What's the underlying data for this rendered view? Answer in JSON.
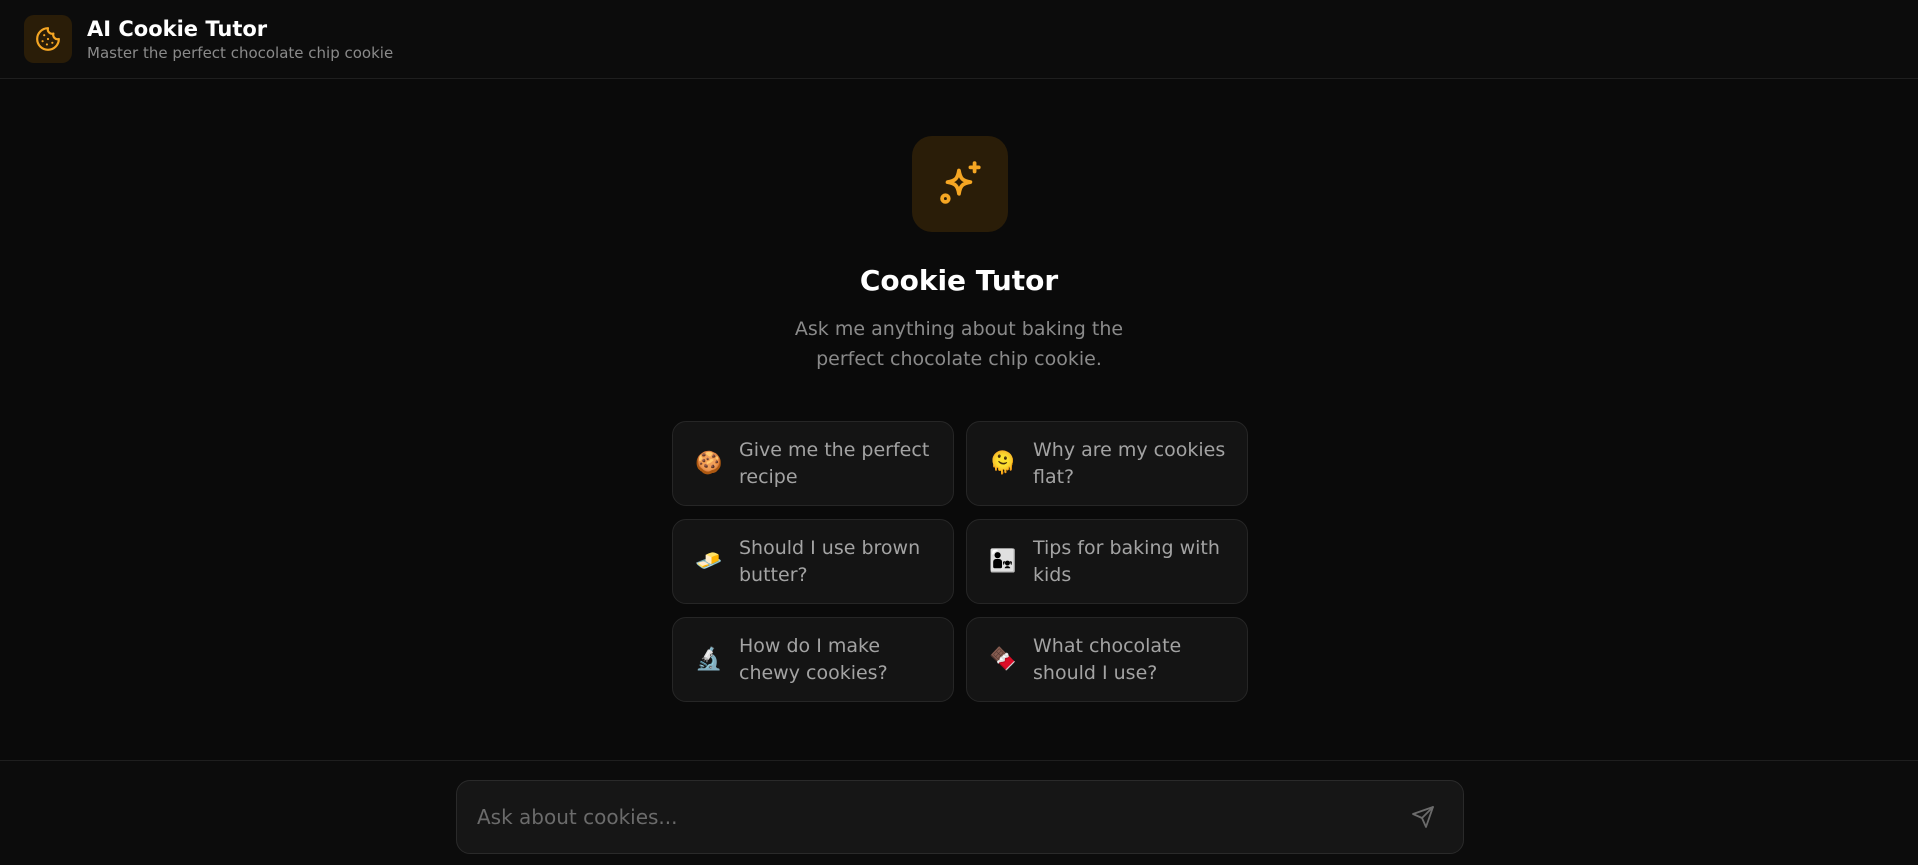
{
  "header": {
    "title": "AI Cookie Tutor",
    "subtitle": "Master the perfect chocolate chip cookie",
    "logo_icon": "cookie-icon"
  },
  "hero": {
    "icon": "sparkles-icon",
    "title": "Cookie Tutor",
    "subtitle": "Ask me anything about baking the perfect chocolate chip cookie."
  },
  "suggestions": [
    {
      "emoji": "🍪",
      "label": "Give me the perfect recipe"
    },
    {
      "emoji": "🫠",
      "label": "Why are my cookies flat?"
    },
    {
      "emoji": "🧈",
      "label": "Should I use brown butter?"
    },
    {
      "emoji": "👨‍👧",
      "label": "Tips for baking with kids"
    },
    {
      "emoji": "🔬",
      "label": "How do I make chewy cookies?"
    },
    {
      "emoji": "🍫",
      "label": "What chocolate should I use?"
    }
  ],
  "composer": {
    "placeholder": "Ask about cookies...",
    "send_icon": "send-icon"
  },
  "colors": {
    "accent": "#f5a623",
    "background": "#0a0a0a",
    "card": "#141414"
  }
}
